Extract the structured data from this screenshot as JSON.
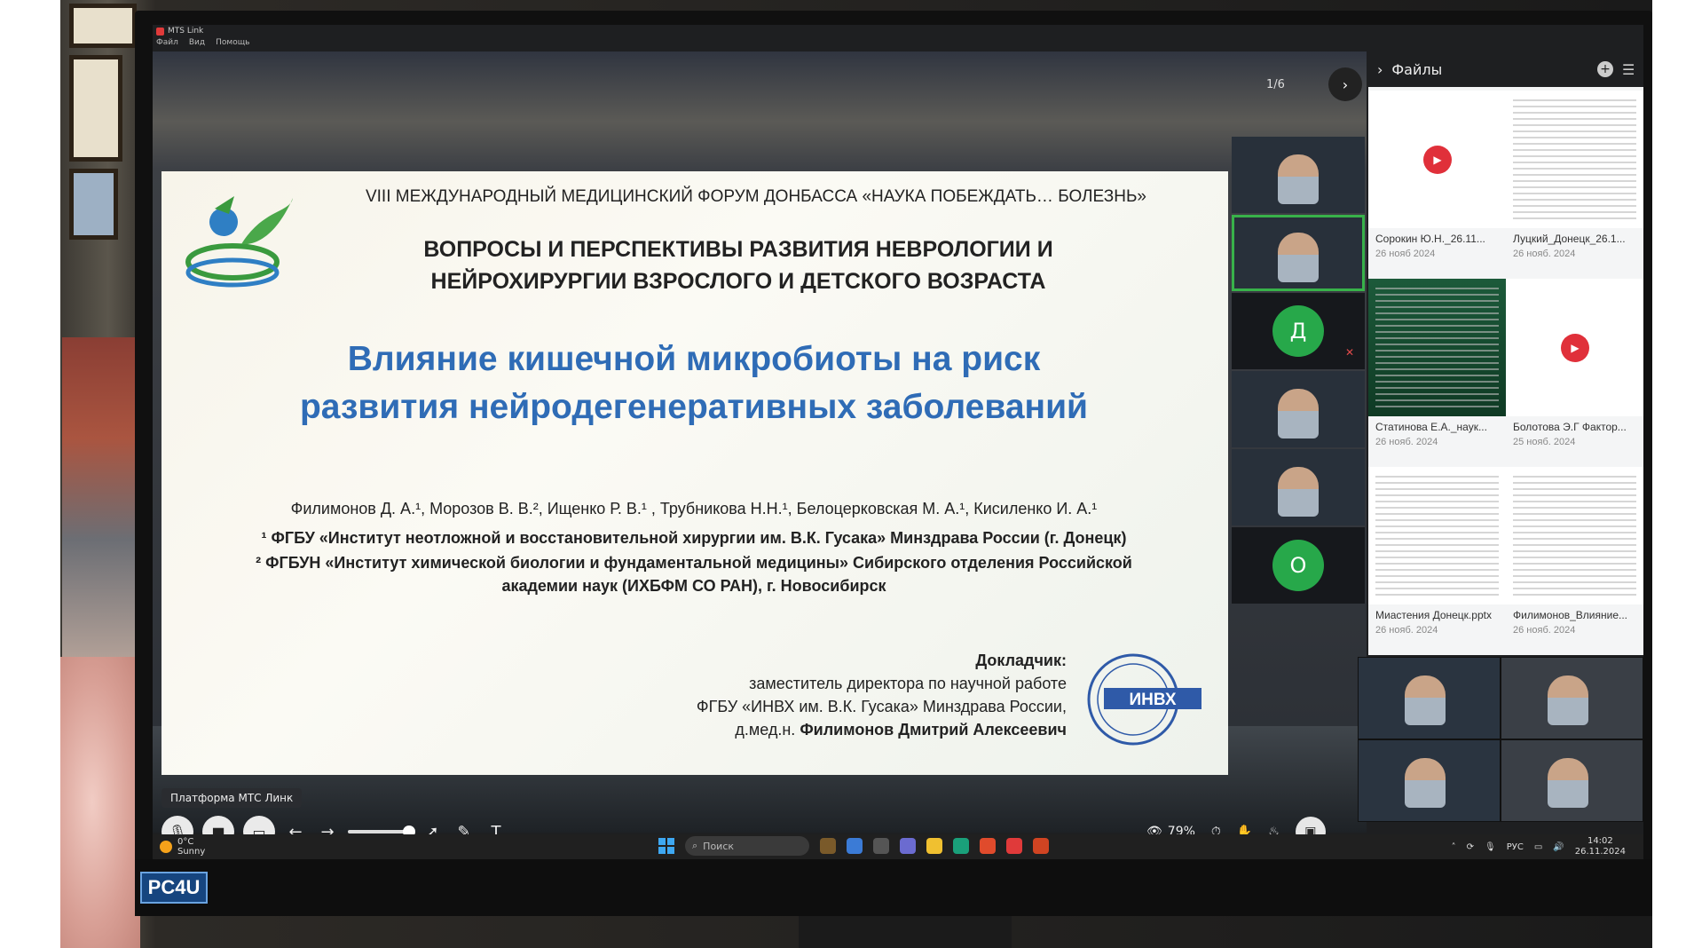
{
  "window": {
    "app_title": "MTS Link",
    "menu": [
      "Файл",
      "Вид",
      "Помощь"
    ]
  },
  "stage": {
    "page_counter": "1/6"
  },
  "slide": {
    "forum_title": "VIII МЕЖДУНАРОДНЫЙ МЕДИЦИНСКИЙ ФОРУМ ДОНБАССА «НАУКА ПОБЕЖДАТЬ… БОЛЕЗНЬ»",
    "section_line1": "ВОПРОСЫ И ПЕРСПЕКТИВЫ РАЗВИТИЯ НЕВРОЛОГИИ И",
    "section_line2": "НЕЙРОХИРУРГИИ ВЗРОСЛОГО И ДЕТСКОГО ВОЗРАСТА",
    "talk_line1": "Влияние кишечной микробиоты на риск",
    "talk_line2": "развития нейродегенеративных заболеваний",
    "authors": "Филимонов Д. А.¹, Морозов В. В.², Ищенко Р. В.¹ , Трубникова Н.Н.¹, Белоцерковская М. А.¹, Кисиленко И. А.¹",
    "affiliation1": "¹ ФГБУ «Институт неотложной и восстановительной хирургии им. В.К. Гусака» Минздрава России (г. Донецк)",
    "affiliation2_line1": "² ФГБУН «Институт химической биологии и фундаментальной медицины» Сибирского отделения Российской",
    "affiliation2_line2": "академии наук (ИХБФМ СО РАН), г. Новосибирск",
    "speaker_label": "Докладчик:",
    "speaker_role": "заместитель директора по научной работе",
    "speaker_org": "ФГБУ «ИНВХ им. В.К. Гусака» Минздрава России,",
    "speaker_degree": "д.мед.н.",
    "speaker_name": "Филимонов Дмитрий Алексеевич",
    "seal_text": "ИНВХ"
  },
  "toolbar": {
    "brand_tag": "Платформа МТС Линк",
    "viewers_percent": "79%"
  },
  "participants": {
    "avatar_d": "Д",
    "avatar_o": "О"
  },
  "files": {
    "title": "Файлы",
    "items": [
      {
        "name": "Сорокин Ю.Н._26.11...",
        "date": "26 нояб 2024",
        "kind": "video"
      },
      {
        "name": "Луцкий_Донецк_26.1...",
        "date": "26 нояб. 2024",
        "kind": "doc"
      },
      {
        "name": "Статинова Е.А._наук...",
        "date": "26 нояб. 2024",
        "kind": "green"
      },
      {
        "name": "Болотова Э.Г Фактор...",
        "date": "25 нояб. 2024",
        "kind": "video"
      },
      {
        "name": "Миастения Донецк.pptx",
        "date": "26 нояб. 2024",
        "kind": "doc"
      },
      {
        "name": "Филимонов_Влияние...",
        "date": "26 нояб. 2024",
        "kind": "doc"
      }
    ]
  },
  "taskbar": {
    "temp": "0°C",
    "weather": "Sunny",
    "search_placeholder": "Поиск",
    "lang": "РУС",
    "time": "14:02",
    "date": "26.11.2024"
  },
  "bezel": {
    "brand": "PC4U"
  },
  "colors": {
    "accent_blue": "#2f6cb6",
    "active_green": "#38b24a",
    "record_red": "#e0303a"
  }
}
